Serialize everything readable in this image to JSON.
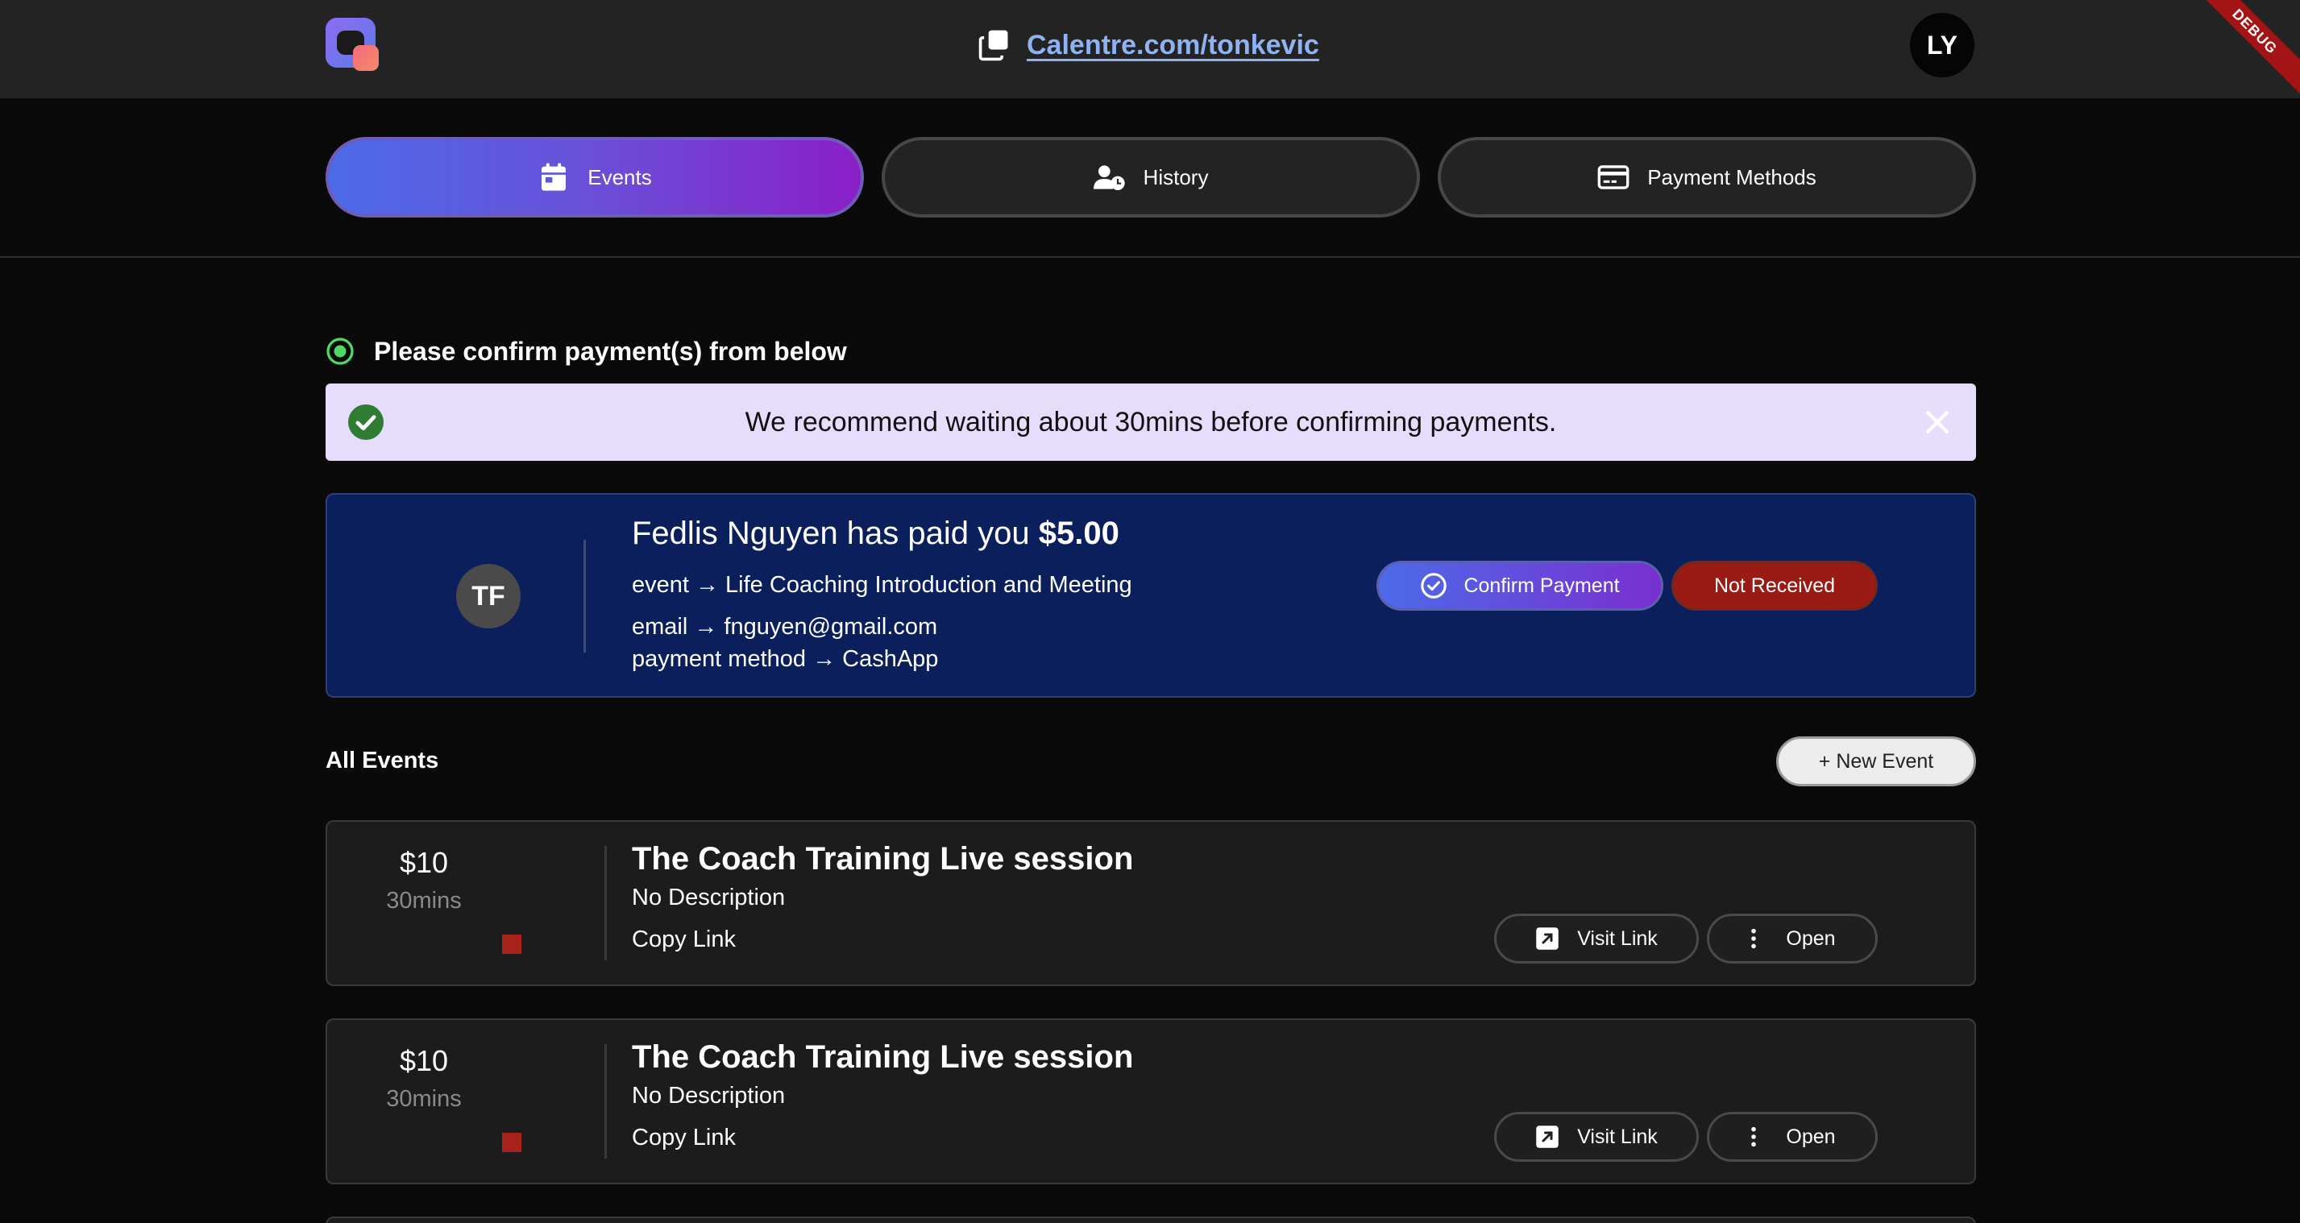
{
  "header": {
    "share_link": "Calentre.com/tonkevic",
    "user_initials": "LY",
    "debug_label": "DEBUG"
  },
  "tabs": [
    {
      "label": "Events",
      "icon": "calendar-icon",
      "active": true
    },
    {
      "label": "History",
      "icon": "user-clock-icon",
      "active": false
    },
    {
      "label": "Payment Methods",
      "icon": "credit-card-icon",
      "active": false
    }
  ],
  "confirm": {
    "heading": "Please confirm payment(s) from below",
    "notice": "We recommend waiting about 30mins before confirming payments."
  },
  "payment": {
    "initials": "TF",
    "title_prefix": "Fedlis Nguyen has paid you",
    "amount": "$5.00",
    "event_line": "event → Life Coaching Introduction and Meeting",
    "email_line": "email → fnguyen@gmail.com",
    "method_line": "payment method → CashApp",
    "confirm_label": "Confirm Payment",
    "not_received_label": "Not Received"
  },
  "events_section": {
    "label": "All Events",
    "new_event_label": "+ New Event"
  },
  "events": [
    {
      "price": "$10",
      "duration": "30mins",
      "title": "The Coach Training Live session",
      "description": "No Description",
      "copy_link": "Copy Link",
      "visit_label": "Visit Link",
      "open_label": "Open"
    },
    {
      "price": "$10",
      "duration": "30mins",
      "title": "The Coach Training Live session",
      "description": "No Description",
      "copy_link": "Copy Link",
      "visit_label": "Visit Link",
      "open_label": "Open"
    }
  ],
  "colors": {
    "accent_start": "#4c6be8",
    "accent_end": "#8a1fc8",
    "payment_card_bg": "#0b1f5c",
    "not_received_red": "#9a1a14",
    "notice_bg": "#e6dcfb",
    "event_color": "#a8211b",
    "link_blue": "#8fb3f2"
  }
}
